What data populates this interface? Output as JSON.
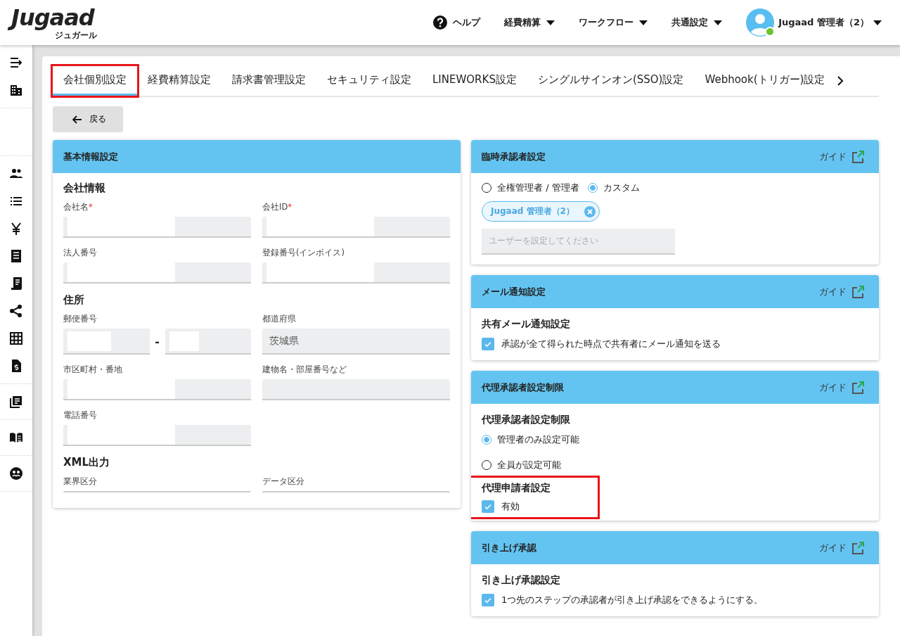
{
  "header": {
    "logo": "Jugaad",
    "logo_sub": "ジュガール",
    "nav": [
      {
        "label": "ヘルプ",
        "kind": "help"
      },
      {
        "label": "経費精算",
        "kind": "menu"
      },
      {
        "label": "ワークフロー",
        "kind": "menu"
      },
      {
        "label": "共通設定",
        "kind": "menu"
      }
    ],
    "user": {
      "name": "Jugaad 管理者（2）",
      "online": true
    }
  },
  "tabs": [
    {
      "label": "会社個別設定",
      "selected": true,
      "highlighted": true
    },
    {
      "label": "経費精算設定",
      "selected": false,
      "highlighted": false
    },
    {
      "label": "請求書管理設定",
      "selected": false,
      "highlighted": false
    },
    {
      "label": "セキュリティ設定",
      "selected": false,
      "highlighted": false
    },
    {
      "label": "LINEWORKS設定",
      "selected": false,
      "highlighted": false
    },
    {
      "label": "シングルサインオン(SSO)設定",
      "selected": false,
      "highlighted": false
    },
    {
      "label": "Webhook(トリガー)設定",
      "selected": false,
      "highlighted": false
    }
  ],
  "back_button": "戻る",
  "basic_card": {
    "title": "基本情報設定",
    "sections": [
      {
        "heading": "会社情報",
        "rows": [
          [
            {
              "label": "会社名",
              "required_mark": "*",
              "kind": "text",
              "masked": true
            },
            {
              "label": "会社ID",
              "required_mark": "*",
              "kind": "text",
              "masked": true
            }
          ],
          [
            {
              "label": "法人番号",
              "kind": "text",
              "masked": true
            },
            {
              "label": "登録番号(インボイス)",
              "kind": "text",
              "masked": true
            }
          ]
        ]
      },
      {
        "heading": "住所",
        "rows": [
          [
            {
              "label": "郵便番号",
              "kind": "postal",
              "masked": true,
              "separator": "-"
            },
            {
              "label": "都道府県",
              "kind": "text",
              "value": "茨城県"
            }
          ],
          [
            {
              "label": "市区町村・番地",
              "kind": "text",
              "masked": true
            },
            {
              "label": "建物名・部屋番号など",
              "kind": "text"
            }
          ],
          [
            {
              "label": "電話番号",
              "kind": "text",
              "masked": true
            }
          ]
        ]
      },
      {
        "heading": "XML出力",
        "rows": [
          [
            {
              "label": "業界区分",
              "kind": "text"
            },
            {
              "label": "データ区分",
              "kind": "text"
            }
          ]
        ]
      }
    ]
  },
  "side_cards": [
    {
      "title": "臨時承認者設定",
      "guide": "ガイド",
      "items": [
        {
          "kind": "radio_group",
          "inline": true,
          "options": [
            {
              "label": "全権管理者 / 管理者",
              "selected": false
            },
            {
              "label": "カスタム",
              "selected": true
            }
          ]
        },
        {
          "kind": "chip",
          "label": "Jugaad 管理者（2）"
        },
        {
          "kind": "input",
          "placeholder": "ユーザーを設定してください"
        }
      ]
    },
    {
      "title": "メール通知設定",
      "guide": "ガイド",
      "items": [
        {
          "kind": "heading",
          "text": "共有メール通知設定"
        },
        {
          "kind": "checkbox",
          "label": "承認が全て得られた時点で共有者にメール通知を送る",
          "checked": true
        }
      ]
    },
    {
      "title": "代理承認者設定制限",
      "guide": "ガイド",
      "items": [
        {
          "kind": "heading",
          "text": "代理承認者設定制限"
        },
        {
          "kind": "radio_group",
          "inline": false,
          "options": [
            {
              "label": "管理者のみ設定可能",
              "selected": true
            },
            {
              "label": "全員が設定可能",
              "selected": false
            }
          ]
        },
        {
          "kind": "highlight",
          "items": [
            {
              "kind": "heading",
              "text": "代理申請者設定"
            },
            {
              "kind": "checkbox",
              "label": "有効",
              "checked": true
            }
          ]
        }
      ]
    },
    {
      "title": "引き上げ承認",
      "guide": "ガイド",
      "items": [
        {
          "kind": "heading",
          "text": "引き上げ承認設定"
        },
        {
          "kind": "checkbox",
          "label": "1つ先のステップの承認者が引き上げ承認をできるようにする。",
          "checked": true
        }
      ]
    }
  ]
}
